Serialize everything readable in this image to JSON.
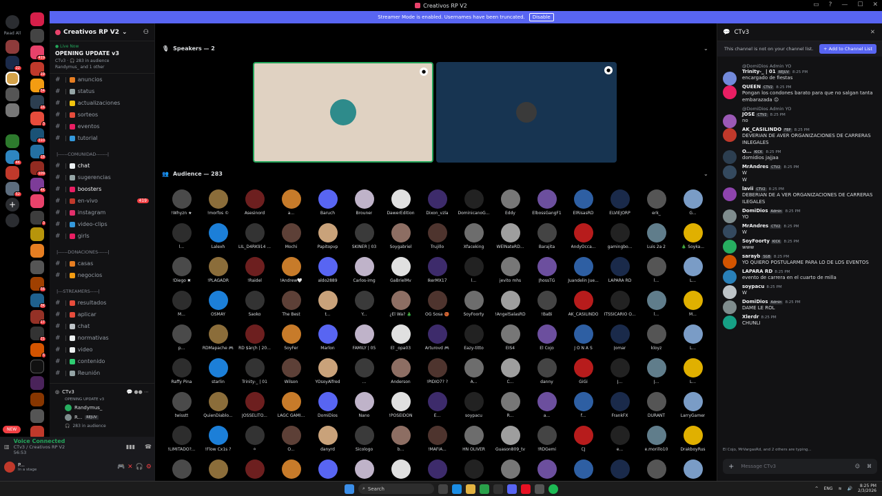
{
  "window": {
    "title": "Creativos RP V2"
  },
  "banner": {
    "text": "Streamer Mode is enabled. Usernames have been truncated.",
    "button": "Disable"
  },
  "left": {
    "read_all": "Read All"
  },
  "server": {
    "name": "Creativos RP V2"
  },
  "live": {
    "badge": "Live Now",
    "title": "OPENING UPDATE v3",
    "meta": "CTv3 · 🎧 283 in audience",
    "people": "Randymus_ and 1 other"
  },
  "channels": [
    {
      "label": "anuncios",
      "emoji_color": "#e67e22"
    },
    {
      "label": "status",
      "emoji_color": "#95a5a6"
    },
    {
      "label": "actualizaciones",
      "emoji_color": "#f1c40f"
    },
    {
      "label": "sorteos",
      "emoji_color": "#e74c3c"
    },
    {
      "label": "eventos",
      "emoji_color": "#e91e63"
    },
    {
      "label": "tutorial",
      "emoji_color": "#3498db"
    }
  ],
  "cat_comunidad": "|------COMUNIDAD-------|",
  "channels2": [
    {
      "label": "chat",
      "emoji_color": "#ecf0f1",
      "active": true
    },
    {
      "label": "sugerencias",
      "emoji_color": "#95a5a6"
    },
    {
      "label": "boosters",
      "emoji_color": "#e91e63",
      "active": true
    },
    {
      "label": "en-vivo",
      "emoji_color": "#c0392b",
      "badge": "419"
    },
    {
      "label": "instagram",
      "emoji_color": "#e1306c"
    },
    {
      "label": "video-clips",
      "emoji_color": "#3498db"
    },
    {
      "label": "girls",
      "emoji_color": "#e91e63"
    }
  ],
  "cat_donaciones": "|------DONACIONES------|",
  "channels3": [
    {
      "label": "casas",
      "emoji_color": "#e67e22"
    },
    {
      "label": "negocios",
      "emoji_color": "#f39c12"
    }
  ],
  "cat_streamers": "|---STREAMERS-----|",
  "channels4": [
    {
      "label": "resultados",
      "emoji_color": "#e74c3c"
    },
    {
      "label": "aplicar",
      "emoji_color": "#e74c3c"
    },
    {
      "label": "chat",
      "emoji_color": "#bdc3c7"
    },
    {
      "label": "normativas",
      "emoji_color": "#ecf0f1"
    },
    {
      "label": "video",
      "emoji_color": "#ecf0f1"
    },
    {
      "label": "contenido",
      "emoji_color": "#2ecc71"
    },
    {
      "label": "Reunión",
      "emoji_color": "#95a5a6"
    }
  ],
  "stage": {
    "name": "CTv3",
    "sub": "OPENING UPDATE v3",
    "u1": "Randymus_",
    "u2": "R...",
    "u2tag": "REJUV",
    "audience": "283 in audience"
  },
  "new_pill": "NEW",
  "voice": {
    "status": "Voice Connected",
    "channel": "CTv3 / Creativos RP V2",
    "time": "56:53"
  },
  "user": {
    "name": "P...",
    "status": "In a stage"
  },
  "speakers": {
    "header": "Speakers — 2"
  },
  "audience": {
    "header": "Audience — 283",
    "members": [
      "!Whyzn ★",
      "!morfos ©",
      "Asesinord",
      "a...",
      "Baruch",
      "Brouner",
      "DawerEdition",
      "Dixon_vzla",
      "DominicanoG...",
      "Eddy",
      "ElbossGangF1",
      "ElRisasRD",
      "ELVIEJORP",
      "erk_",
      "G...",
      "l...",
      "Lalexh",
      "LIL_D4RK914 ...",
      "Mochi",
      "Papitopvp",
      "SKINER | 03",
      "Soygabriel",
      "Trujillo",
      "Xfaceking",
      "WElNateRD...",
      "Barajita",
      "AndyOcca...",
      "gamingbo...",
      "Luis 2a 2",
      "🎄 Soyka...",
      "!Diego ✖",
      "!PLAGADR",
      "!Raidel",
      "!Andrew🤍",
      "aldo2889",
      "Carlos-img",
      "GaBrielMv",
      "IkerMX17",
      "l...",
      "jevito mhs",
      "JhossTG",
      "Juandelin Jue...",
      "LAPARA RD",
      "l...",
      "L...",
      "M...",
      "OSMAY",
      "Saoko",
      "The Best",
      "t...",
      "Y...",
      "¿El Wa? 🎄",
      "OG Sosa 🏀",
      "SoyFoorty",
      "!AngelSalasRD",
      "!BaBi",
      "AK_CASILINDO",
      "ITSSICARIO O...",
      "l...",
      "M...",
      "p...",
      "RDMapache 🎮",
      "RD $àrçh | 20...",
      "SoyFer",
      "Marlon",
      "FAMILY | 05",
      "El _opa03",
      "Arturovd 🎮",
      "Eazy-titto",
      "EIS4",
      "El Cojo",
      "J O N A S",
      "Jomar",
      "kloyz",
      "L...",
      "Raffy Pina",
      "starlin",
      "Trinity-_ | 01",
      "Wilson",
      "YOsoyAlfred",
      "...",
      "Anderson",
      "!PIDIO7? ?",
      "A...",
      "C...",
      "danny",
      "GiGi",
      "J...",
      "J...",
      "L...",
      "twisstt",
      "QuienDiablo...",
      "JOSSELITO...",
      "LAGC GAMI...",
      "DomiDios",
      "Nano",
      "!POSEIDON",
      "E...",
      "soypacu",
      "R...",
      "a...",
      "f...",
      "FrankFX",
      "DURANT",
      "LarryGamer",
      "!LIMITADO?...",
      "!Flow Cx1s ?",
      "⚪",
      "O...",
      "danyrd",
      "Sicologo",
      "b...",
      "!MAFIA...",
      "HN OLIVER",
      "Guason809_tv",
      "!RDGemi",
      "CJ",
      "e...",
      "e.morillo10",
      "DrakboyRus",
      "",
      "",
      "",
      "",
      "",
      "",
      "",
      "",
      "",
      "",
      "",
      "",
      "",
      "",
      ""
    ]
  },
  "chat": {
    "title": "CTv3",
    "notice": "This channel is not on your channel list.",
    "add_btn": "Add to Channel List",
    "typing": "El Cojo, MrVargasRd, and 2 others are typing...",
    "placeholder": "Message CTv3",
    "messages": [
      {
        "reply": "@DomiDios  Admin YO",
        "author": "Trinity-_ | 01",
        "tag": "REJUV",
        "time": "8:25 PM",
        "text": "encargado de fiestas",
        "color": "#7289da"
      },
      {
        "reply": "",
        "author": "QUEEN",
        "tag": "CTV2",
        "time": "8:25 PM",
        "text": "Pongan los condones barato para que no salgan tanta embarazada 😐",
        "color": "#e91e63"
      },
      {
        "reply": "@DomiDios  Admin YO",
        "author": "JOSE",
        "tag": "CTV2",
        "time": "8:25 PM",
        "text": "no",
        "color": "#9b59b6"
      },
      {
        "reply": "",
        "author": "AK_CASILINDO",
        "tag": "FBP",
        "time": "8:25 PM",
        "text": "DEVERIAN DE AVER ORGANIZACIONES DE CARRERAS INLEGALES",
        "color": "#c0392b"
      },
      {
        "reply": "",
        "author": "O...",
        "tag": "KICK",
        "time": "8:25 PM",
        "text": "domidios jajjaa",
        "color": "#2c3e50"
      },
      {
        "reply": "",
        "author": "MrAndres",
        "tag": "CTV2",
        "time": "8:25 PM",
        "text": "W\nW",
        "color": "#34495e"
      },
      {
        "reply": "",
        "author": "lavii",
        "tag": "CTV2",
        "time": "8:25 PM",
        "text": "DEBERIAN DE A VER ORGANIZACIONES DE CARRERAS ILEGALES",
        "color": "#8e44ad"
      },
      {
        "reply": "",
        "author": "DomiDios",
        "tag": "Admin",
        "time": "8:25 PM",
        "text": "YO",
        "color": "#7f8c8d"
      },
      {
        "reply": "",
        "author": "MrAndres",
        "tag": "CTV2",
        "time": "8:25 PM",
        "text": "W",
        "color": "#34495e"
      },
      {
        "reply": "",
        "author": "SoyFoorty",
        "tag": "KICK",
        "time": "8:25 PM",
        "text": "www",
        "color": "#27ae60"
      },
      {
        "reply": "",
        "author": "sarayb",
        "tag": "SGB",
        "time": "8:25 PM",
        "text": "YO QUIERO POSTULARME PARA LO DE LOS EVENTOS",
        "color": "#d35400"
      },
      {
        "reply": "",
        "author": "LAPARA RD",
        "tag": "",
        "time": "8:25 PM",
        "text": "evento de carrera en el cuarto de milla",
        "color": "#2980b9"
      },
      {
        "reply": "",
        "author": "soypacu",
        "tag": "",
        "time": "8:25 PM",
        "text": "W",
        "color": "#bdc3c7"
      },
      {
        "reply": "",
        "author": "DomiDios",
        "tag": "Admin",
        "time": "8:25 PM",
        "text": "DAME LE ROL",
        "color": "#7f8c8d"
      },
      {
        "reply": "",
        "author": "Xlerdr",
        "tag": "",
        "time": "8:25 PM",
        "text": "CHUNLI",
        "color": "#16a085"
      }
    ]
  },
  "taskbar": {
    "search": "Search",
    "lang": "ENG",
    "time": "8:25 PM",
    "date": "2/3/2026"
  }
}
